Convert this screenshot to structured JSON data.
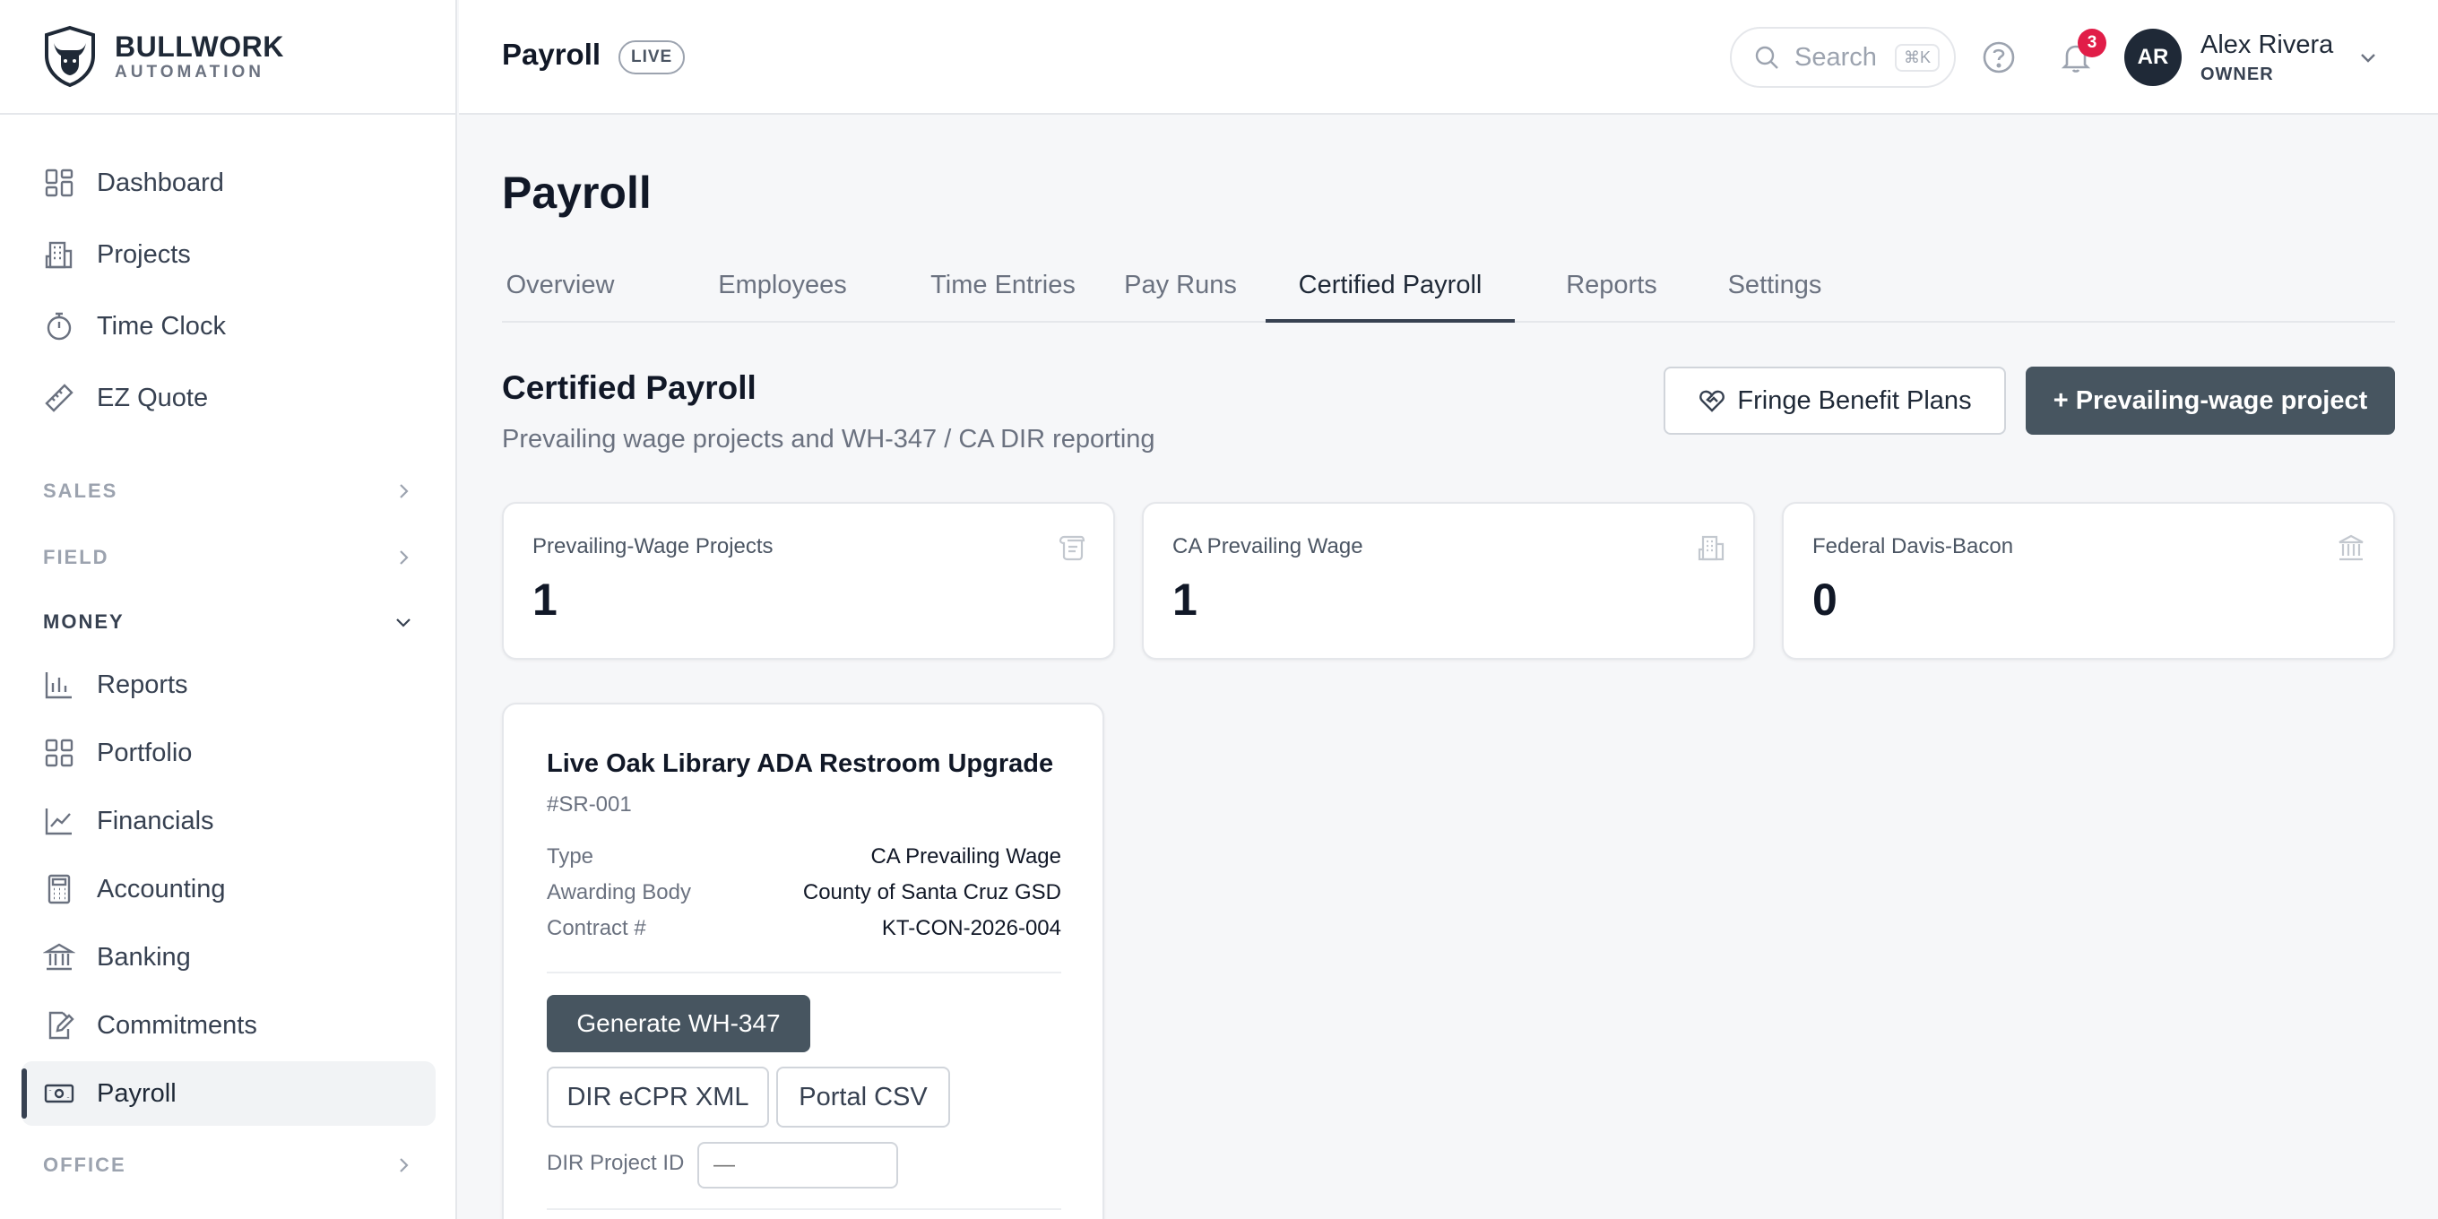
{
  "brand": {
    "name": "BULLWORK",
    "sub": "AUTOMATION"
  },
  "sidebar": {
    "items": [
      {
        "label": "Dashboard",
        "icon": "dashboard-icon"
      },
      {
        "label": "Projects",
        "icon": "building-icon"
      },
      {
        "label": "Time Clock",
        "icon": "stopwatch-icon"
      },
      {
        "label": "EZ Quote",
        "icon": "ruler-icon"
      }
    ],
    "sections": [
      {
        "label": "SALES",
        "open": false
      },
      {
        "label": "FIELD",
        "open": false
      },
      {
        "label": "MONEY",
        "open": true
      },
      {
        "label": "OFFICE",
        "open": false
      }
    ],
    "money_items": [
      {
        "label": "Reports",
        "icon": "bar-chart-icon"
      },
      {
        "label": "Portfolio",
        "icon": "grid-icon"
      },
      {
        "label": "Financials",
        "icon": "line-chart-icon"
      },
      {
        "label": "Accounting",
        "icon": "calculator-icon"
      },
      {
        "label": "Banking",
        "icon": "bank-icon"
      },
      {
        "label": "Commitments",
        "icon": "document-edit-icon"
      },
      {
        "label": "Payroll",
        "icon": "cash-icon",
        "active": true
      }
    ]
  },
  "header": {
    "title": "Payroll",
    "badge": "LIVE",
    "search_placeholder": "Search",
    "search_shortcut": "⌘K",
    "notification_count": "3",
    "user": {
      "initials": "AR",
      "name": "Alex Rivera",
      "role": "OWNER"
    }
  },
  "main": {
    "title": "Payroll",
    "tabs": [
      "Overview",
      "Employees",
      "Time Entries",
      "Pay Runs",
      "Certified Payroll",
      "Reports",
      "Settings"
    ],
    "active_tab": "Certified Payroll",
    "section_title": "Certified Payroll",
    "section_subtitle": "Prevailing wage projects and WH-347 / CA DIR reporting",
    "fringe_button": "Fringe Benefit Plans",
    "add_button": "+ Prevailing-wage project",
    "stats": [
      {
        "label": "Prevailing-Wage Projects",
        "value": "1",
        "icon": "scroll-icon"
      },
      {
        "label": "CA Prevailing Wage",
        "value": "1",
        "icon": "building-icon"
      },
      {
        "label": "Federal Davis-Bacon",
        "value": "0",
        "icon": "bank-icon"
      }
    ],
    "project": {
      "name": "Live Oak Library ADA Restroom Upgrade",
      "id": "#SR-001",
      "fields": [
        {
          "key": "Type",
          "value": "CA Prevailing Wage"
        },
        {
          "key": "Awarding Body",
          "value": "County of Santa Cruz GSD"
        },
        {
          "key": "Contract #",
          "value": "KT-CON-2026-004"
        }
      ],
      "generate_button": "Generate WH-347",
      "xml_button": "DIR eCPR XML",
      "csv_button": "Portal CSV",
      "dir_label": "DIR Project ID",
      "dir_placeholder": "—"
    }
  },
  "colors": {
    "accent": "#475560",
    "badge": "#e11d48",
    "avatar": "#1f2937"
  }
}
